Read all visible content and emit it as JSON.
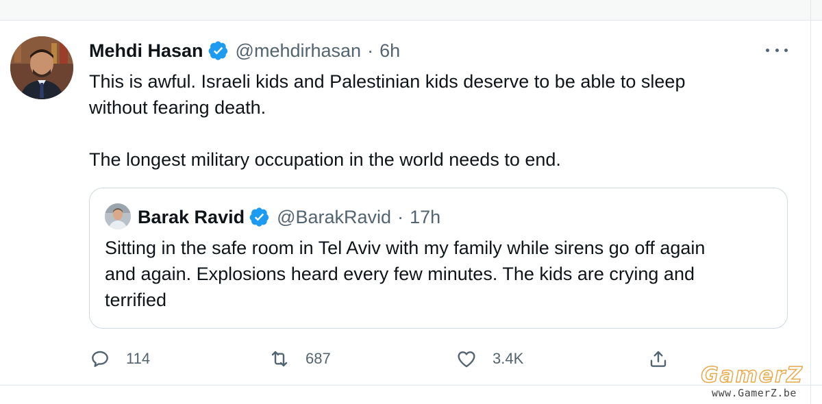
{
  "tweet": {
    "author_name": "Mehdi Hasan",
    "handle": "@mehdirhasan",
    "separator": "·",
    "time": "6h",
    "verified_icon": "verified-badge-icon",
    "text_line1": "This is awful. Israeli kids and Palestinian kids deserve to be able to sleep",
    "text_line2": "without fearing death.",
    "text_line3": "The longest military occupation in the world needs to end."
  },
  "quote": {
    "author_name": "Barak Ravid",
    "handle": "@BarakRavid",
    "separator": "·",
    "time": "17h",
    "text_line1": "Sitting in the safe room in Tel Aviv with my family while sirens go off again",
    "text_line2": "and again. Explosions heard every few minutes. The kids are crying and",
    "text_line3": "terrified"
  },
  "actions": {
    "reply_count": "114",
    "retweet_count": "687",
    "like_count": "3.4K"
  },
  "watermark": {
    "logo": "GamerZ",
    "url": "www.GamerZ.be"
  },
  "colors": {
    "verified": "#1d9bf0",
    "secondary_text": "#536471",
    "primary_text": "#0f1419",
    "border": "#cfd9de"
  }
}
